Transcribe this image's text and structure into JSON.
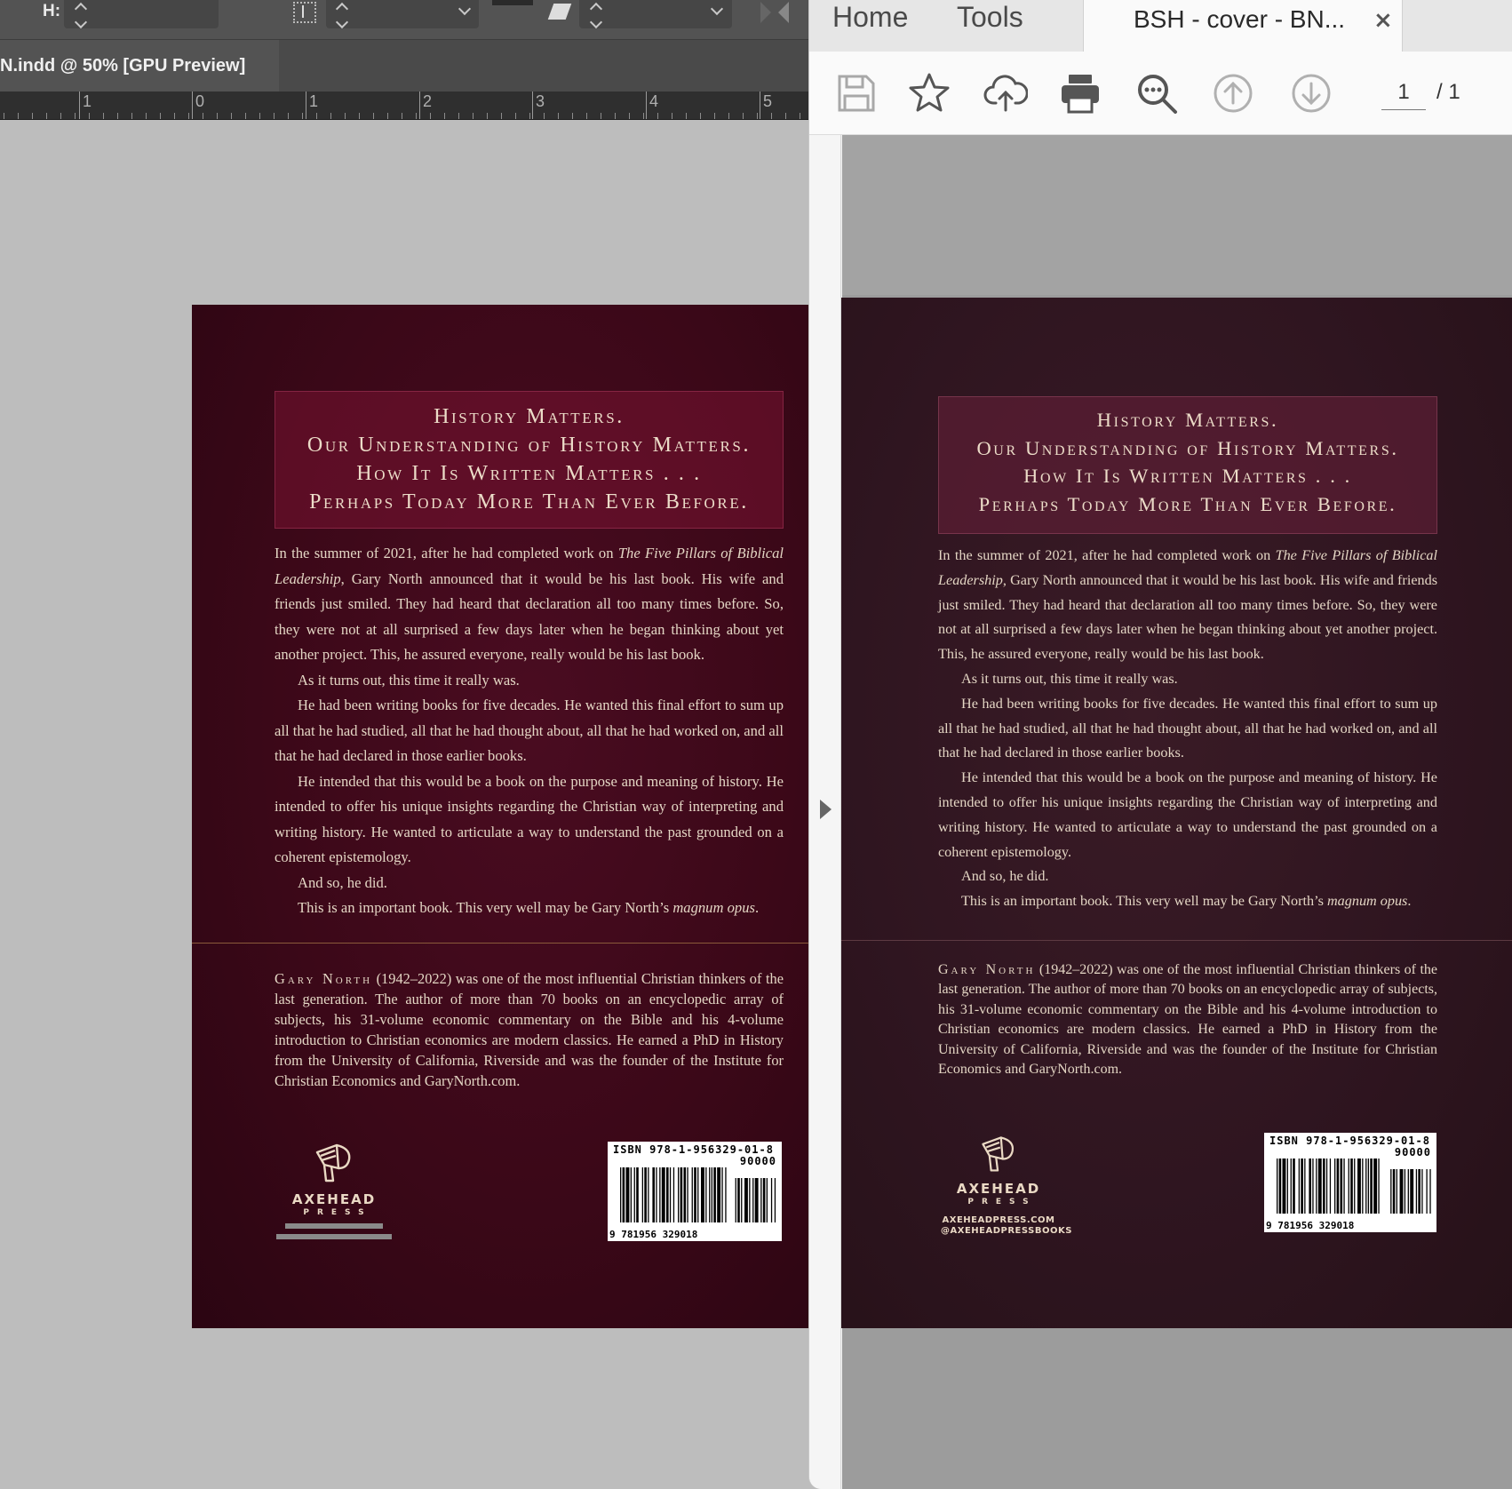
{
  "indesign": {
    "toolbar": {
      "height_label": "H:"
    },
    "doc_tab": "N.indd @ 50% [GPU Preview]",
    "ruler_numbers": [
      "1",
      "0",
      "1",
      "2",
      "3",
      "4",
      "5"
    ]
  },
  "acrobat": {
    "tabs": {
      "home": "Home",
      "tools": "Tools",
      "document": "BSH - cover - BN...",
      "close": "×"
    },
    "toolbar": {
      "icons": [
        "save-icon",
        "bookmark-star-icon",
        "upload-cloud-icon",
        "print-icon",
        "zoom-icon",
        "page-up-icon",
        "page-down-icon"
      ],
      "page_current": "1",
      "page_total": "/ 1"
    }
  },
  "cover": {
    "quote_lines": [
      "History Matters.",
      "Our Understanding of History Matters.",
      "How It Is Written Matters . . .",
      "Perhaps Today More Than Ever Before."
    ],
    "paragraphs": {
      "p1_a": "In the summer of 2021, after he had completed work on ",
      "p1_title": "The Five Pillars of Biblical Leadership",
      "p1_b": ", Gary North announced that it would be his last book. His wife and friends just smiled. They had heard that declaration all too many times before. So, they were not at all surprised a few days later when he began thinking about yet another project. This, he assured everyone, really would be his last book.",
      "p2": "As it turns out, this time it really was.",
      "p3": "He had been writing books for five decades. He wanted this final effort to sum up all that he had studied, all that he had thought about, all that he had worked on, and all that he had declared in those earlier books.",
      "p4": "He intended that this would be a book on the purpose and meaning of history. He intended to offer his unique insights regarding the Christian way of inter­preting and writing history. He wanted to articulate a way to understand the past grounded on a coherent epistemology.",
      "p5": "And so, he did.",
      "p6_a": "This is an important book. This very well may be Gary North’s ",
      "p6_em": "magnum opus",
      "p6_b": "."
    },
    "bio": {
      "name": "Gary North",
      "text": " (1942–2022) was one of the most influential Christian think­ers of the last generation. The author of more than 70 books on an encyclopedic array of subjects, his 31-volume economic commentary on the Bible and his 4-vol­ume introduction to Christian economics are modern classics. He earned a PhD in History from the University of California, Riverside and was the founder of the Institute for Christian Economics and GaryNorth.com."
    },
    "publisher": {
      "name": "AXEHEAD",
      "press": "PRESS",
      "website": "AXEHEADPRESS.COM",
      "social": "@AXEHEADPRESSBOOKS"
    },
    "barcode": {
      "isbn": "ISBN 978-1-956329-01-8",
      "price_code": "90000",
      "ean_digits": "9 781956 329018"
    }
  },
  "colors": {
    "indesign_cover": "#3b0818",
    "acrobat_cover": "#2f1520",
    "cover_text": "#e4d6c4"
  }
}
